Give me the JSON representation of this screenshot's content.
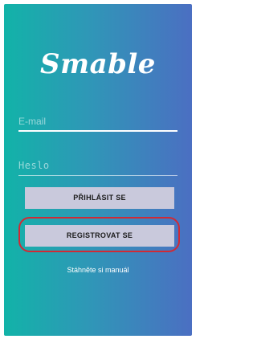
{
  "app": {
    "logo_text": "Smable"
  },
  "form": {
    "email_placeholder": "E-mail",
    "password_placeholder": "Heslo"
  },
  "actions": {
    "login_label": "PŘIHLÁSIT SE",
    "register_label": "REGISTROVAT SE",
    "manual_link": "Stáhněte si manuál"
  },
  "colors": {
    "gradient_start": "#12b3a8",
    "gradient_end": "#4b6fc2",
    "button_bg": "#c9c9dc",
    "highlight": "#d02a35"
  }
}
